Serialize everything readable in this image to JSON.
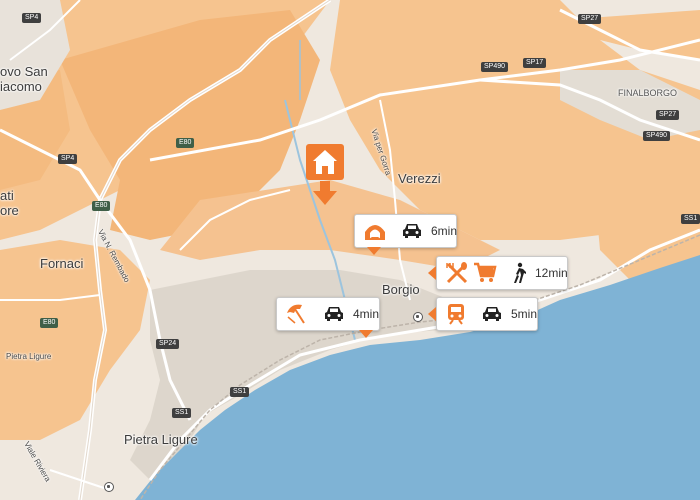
{
  "map": {
    "places": {
      "borgio": "Borgio",
      "verezzi": "Verezzi",
      "fornaci": "Fornaci",
      "pietra_ligure": "Pietra Ligure",
      "pietra_ligure_small": "Pietra Ligure",
      "finalborgo": "FINALBORGO",
      "vovo_san": "ovo San",
      "giacomo": "iacomo",
      "ati": "ati",
      "ore": "ore",
      "via_per_gorra": "Via per Gorra",
      "via_rembado": "Via N. Rembado",
      "viale_riviera": "Viale Riviera"
    },
    "roads": {
      "sp4_top": "SP4",
      "sp4_mid": "SP4",
      "sp27_a": "SP27",
      "sp27_b": "SP27",
      "sp17": "SP17",
      "sp490_a": "SP490",
      "sp490_b": "SP490",
      "e80_a": "E80",
      "e80_b": "E80",
      "e80_c": "E80",
      "sp24": "SP24",
      "ss1_a": "SS1",
      "ss1_b": "SS1",
      "ss1_c": "SS1"
    },
    "colors": {
      "sea": "#7fb3d5",
      "land": "#efe8df",
      "orange_area": "#f6c48f",
      "accent": "#f07b2f",
      "urban": "#ddd6cc"
    },
    "home_marker": {
      "icon": "home-icon"
    },
    "cards": [
      {
        "icons": [
          "tunnel-cave-icon",
          "car-icon"
        ],
        "time": "6min"
      },
      {
        "icons": [
          "restaurant-icon",
          "shopping-cart-icon",
          "walking-person-icon"
        ],
        "time": "12min"
      },
      {
        "icons": [
          "beach-umbrella-icon",
          "car-icon"
        ],
        "time": "4min"
      },
      {
        "icons": [
          "train-icon",
          "car-icon"
        ],
        "time": "5min"
      }
    ]
  }
}
